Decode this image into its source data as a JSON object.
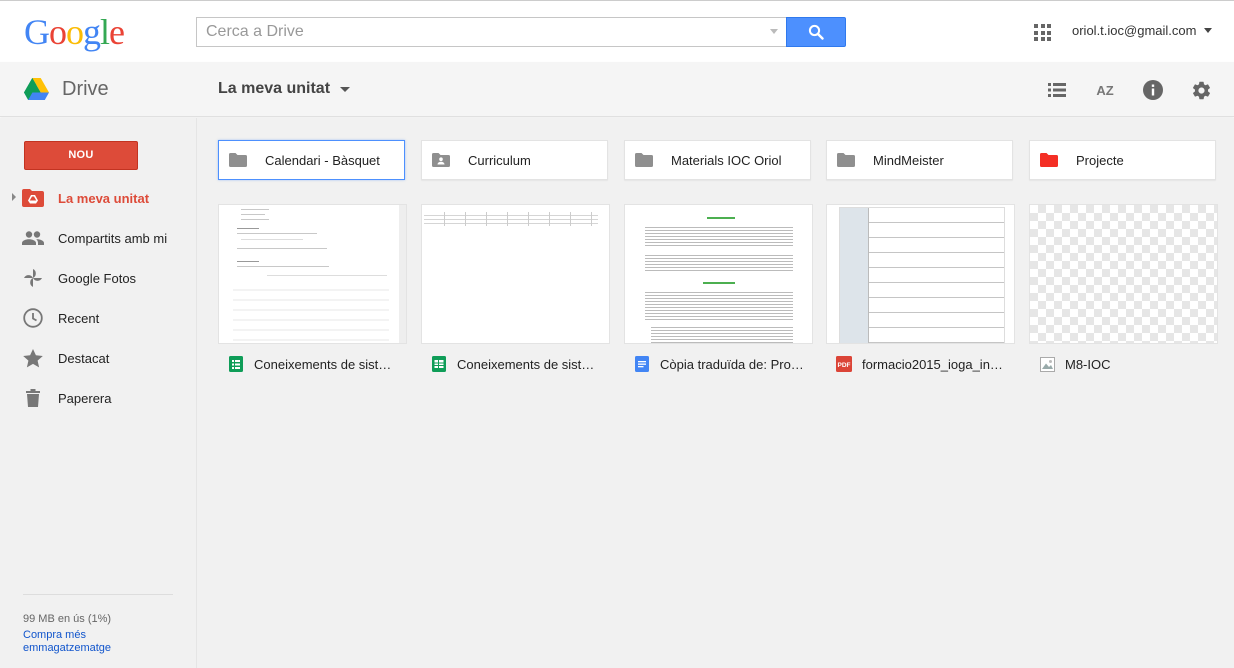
{
  "header": {
    "logo_letters": [
      {
        "ch": "G",
        "color": "#4285f4"
      },
      {
        "ch": "o",
        "color": "#ea4335"
      },
      {
        "ch": "o",
        "color": "#fbbc05"
      },
      {
        "ch": "g",
        "color": "#4285f4"
      },
      {
        "ch": "l",
        "color": "#34a853"
      },
      {
        "ch": "e",
        "color": "#ea4335"
      }
    ],
    "search_placeholder": "Cerca a Drive",
    "search_icon": "search-icon",
    "apps_icon": "apps-grid-icon",
    "account_email": "oriol.t.ioc@gmail.com"
  },
  "subheader": {
    "app_name": "Drive",
    "location": "La meva unitat",
    "tools": [
      "list-view-icon",
      "sort-az-icon",
      "info-icon",
      "settings-icon"
    ],
    "sort_label": "AZ"
  },
  "sidebar": {
    "new_button": "NOU",
    "items": [
      {
        "label": "La meva unitat",
        "icon": "my-drive-icon",
        "active": true
      },
      {
        "label": "Compartits amb mi",
        "icon": "shared-people-icon",
        "active": false
      },
      {
        "label": "Google Fotos",
        "icon": "google-photos-icon",
        "active": false
      },
      {
        "label": "Recent",
        "icon": "clock-icon",
        "active": false
      },
      {
        "label": "Destacat",
        "icon": "star-icon",
        "active": false
      },
      {
        "label": "Paperera",
        "icon": "trash-icon",
        "active": false
      }
    ],
    "storage_used": "99 MB en ús (1%)",
    "storage_link": "Compra més emmagatzematge"
  },
  "folders": [
    {
      "name": "Calendari - Bàsquet",
      "icon": "folder-icon",
      "color": "#8f8f8f",
      "selected": true
    },
    {
      "name": "Curriculum",
      "icon": "shared-folder-icon",
      "color": "#8f8f8f",
      "selected": false
    },
    {
      "name": "Materials IOC Oriol",
      "icon": "folder-icon",
      "color": "#8f8f8f",
      "selected": false
    },
    {
      "name": "MindMeister",
      "icon": "folder-icon",
      "color": "#8f8f8f",
      "selected": false
    },
    {
      "name": "Projecte",
      "icon": "folder-icon",
      "color": "#f42f25",
      "selected": false
    }
  ],
  "files": [
    {
      "name": "Coneixements de sist…",
      "type_icon": "google-forms-icon",
      "thumb": "form"
    },
    {
      "name": "Coneixements de sist…",
      "type_icon": "google-sheets-icon",
      "thumb": "sheet"
    },
    {
      "name": "Còpia traduïda de: Pro…",
      "type_icon": "google-docs-icon",
      "thumb": "doc"
    },
    {
      "name": "formacio2015_ioga_in…",
      "type_icon": "pdf-icon",
      "thumb": "pdf"
    },
    {
      "name": "M8-IOC",
      "type_icon": "image-icon",
      "thumb": "image"
    }
  ],
  "pdf_label": "PDF"
}
